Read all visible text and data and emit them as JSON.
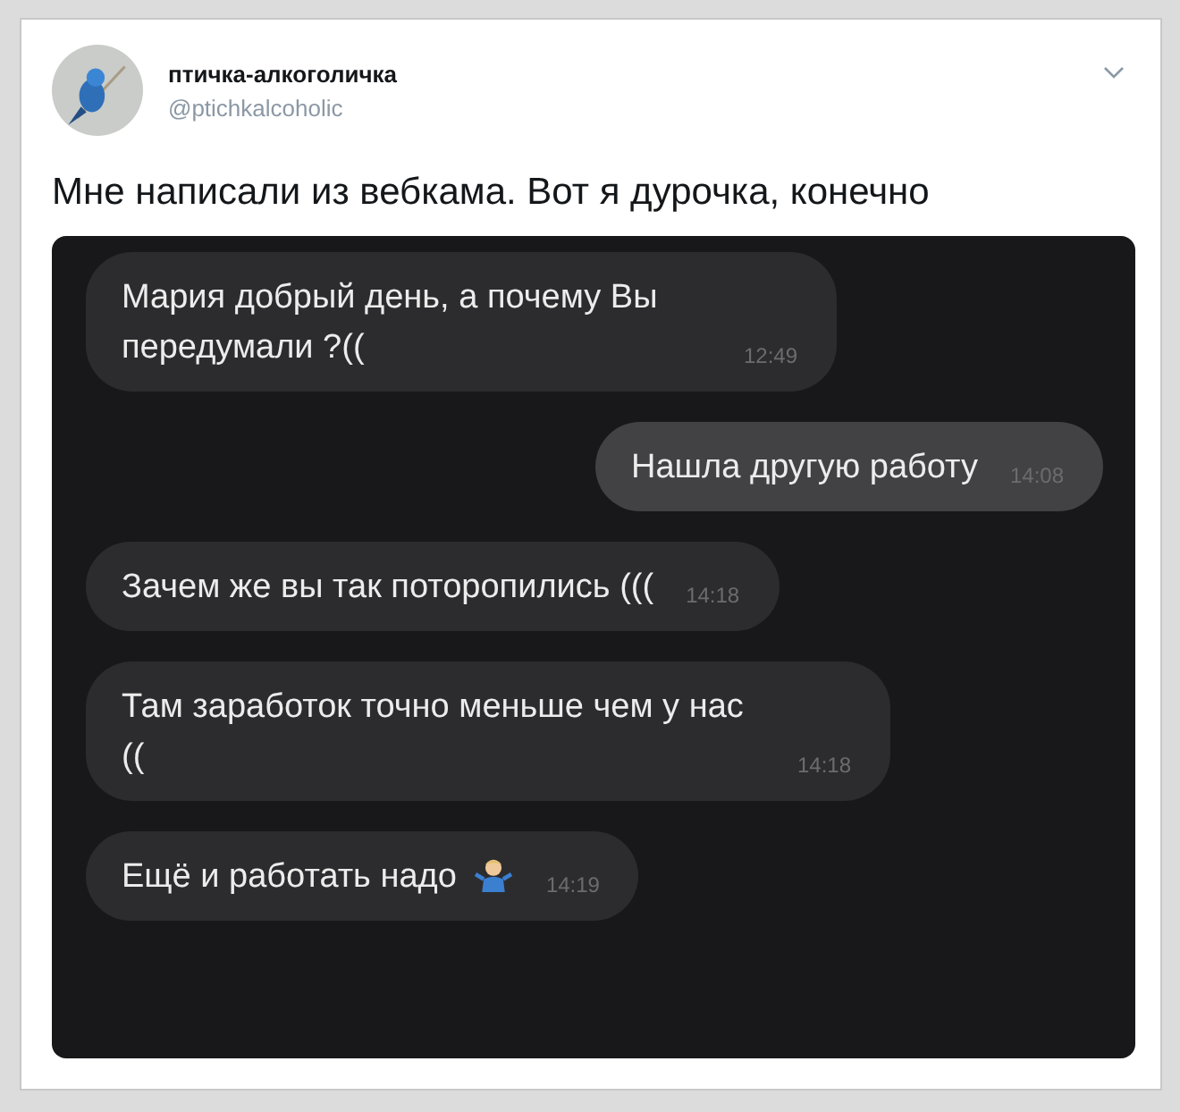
{
  "tweet": {
    "author": {
      "name": "птичка-алкоголичка",
      "handle": "@ptichkalcoholic"
    },
    "text": "Мне написали из вебкама. Вот я дурочка, конечно"
  },
  "chat": {
    "messages": [
      {
        "kind": "incoming",
        "text": "Мария добрый день, а почему Вы передумали ?((",
        "time": "12:49",
        "shrug_emoji": false
      },
      {
        "kind": "outgoing",
        "text": "Нашла другую работу",
        "time": "14:08",
        "shrug_emoji": false
      },
      {
        "kind": "incoming",
        "text": "Зачем же вы так поторопились (((",
        "time": "14:18",
        "shrug_emoji": false
      },
      {
        "kind": "incoming",
        "text": "Там заработок точно меньше чем у нас ((",
        "time": "14:18",
        "shrug_emoji": false
      },
      {
        "kind": "incoming",
        "text": "Ещё и работать надо",
        "time": "14:19",
        "shrug_emoji": true
      }
    ]
  }
}
